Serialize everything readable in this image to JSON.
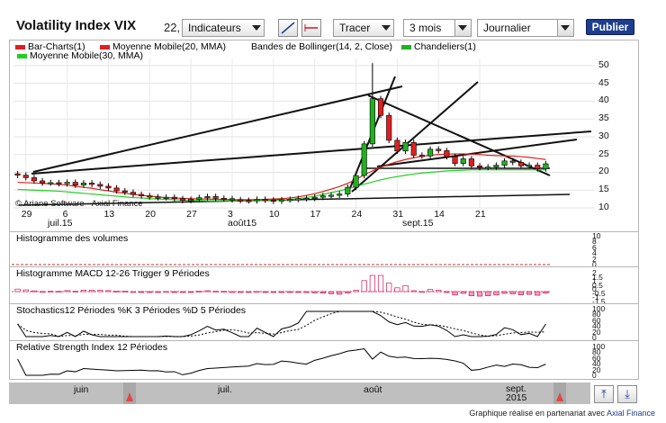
{
  "toolbar": {
    "title": "Volatility Index VIX",
    "number": "22,",
    "indicators_label": "Indicateurs",
    "draw_label": "Tracer",
    "period_value": "3 mois",
    "interval_value": "Journalier",
    "publish_label": "Publier",
    "line_tool_icon": "diagonal-line-icon",
    "hline_tool_icon": "horizontal-line-icon"
  },
  "legend": {
    "items": [
      {
        "label": "Bar-Charts(1)",
        "color": "#e02020",
        "icon": "bar-swatch"
      },
      {
        "label": "Moyenne Mobile(20, MMA)",
        "color": "#e02020",
        "icon": "line-swatch"
      },
      {
        "label": "Bandes de Bollinger(14, 2, Close)",
        "color": "",
        "icon": ""
      },
      {
        "label": "Chandeliers(1)",
        "color": "#20b020",
        "icon": "bar-swatch"
      },
      {
        "label": "Moyenne Mobile(30, MMA)",
        "color": "#20d020",
        "icon": "line-swatch"
      }
    ]
  },
  "main_chart": {
    "watermark": "© Ariane Software - Axial Finance",
    "y_ticks": [
      "50",
      "45",
      "40",
      "35",
      "30",
      "25",
      "20",
      "15",
      "10"
    ],
    "x_ticks": [
      "29",
      "6",
      "13",
      "20",
      "27",
      "3",
      "10",
      "17",
      "24",
      "31",
      "14",
      "21"
    ],
    "month_labels": [
      "juil.15",
      "août15",
      "sept.15"
    ]
  },
  "chart_data": {
    "type": "candlestick",
    "ylim": [
      10,
      52
    ],
    "y_ticks": [
      10,
      15,
      20,
      25,
      30,
      35,
      40,
      45,
      50
    ],
    "x_tick_labels": [
      "29",
      "6",
      "13",
      "20",
      "27",
      "3",
      "10",
      "17",
      "24",
      "31",
      "14",
      "21"
    ],
    "series": [
      {
        "name": "Chandeliers(1)",
        "close": [
          19.2,
          18.5,
          17.6,
          17.0,
          17.1,
          16.8,
          17.2,
          16.4,
          17.0,
          16.6,
          16.1,
          15.6,
          14.8,
          14.4,
          13.8,
          13.4,
          13.1,
          12.9,
          13.0,
          12.6,
          12.1,
          12.4,
          12.9,
          13.2,
          12.7,
          12.6,
          12.3,
          12.1,
          12.0,
          12.4,
          12.2,
          11.9,
          12.3,
          12.4,
          12.6,
          12.7,
          13.0,
          13.4,
          13.6,
          13.9,
          15.8,
          19.1,
          28.0,
          40.7,
          36.0,
          29.0,
          26.0,
          28.4,
          24.8,
          24.6,
          26.5,
          26.1,
          24.4,
          22.5,
          23.8,
          21.8,
          21.4,
          21.5,
          22.0,
          23.2,
          22.8,
          21.8,
          22.0,
          21.0,
          22.4
        ]
      },
      {
        "name": "Moyenne Mobile(20, MMA)",
        "values": [
          17.2,
          17.1,
          17.0,
          16.9,
          16.8,
          16.6,
          16.4,
          16.1,
          15.8,
          15.5,
          15.1,
          14.8,
          14.4,
          14.1,
          13.8,
          13.5,
          13.3,
          13.1,
          12.9,
          12.8,
          12.7,
          12.6,
          12.5,
          12.5,
          12.4,
          12.4,
          12.3,
          12.3,
          12.3,
          12.3,
          12.4,
          12.5,
          12.6,
          12.8,
          13.1,
          13.5,
          14.0,
          14.6,
          15.3,
          16.0,
          16.9,
          18.0,
          19.3,
          20.4,
          21.4,
          22.3,
          23.0,
          23.6,
          24.1,
          24.5,
          24.8,
          25.0,
          25.1,
          25.2,
          25.2,
          25.1,
          25.0,
          24.8,
          24.7,
          24.6,
          24.6,
          24.4,
          24.2,
          23.9,
          23.6
        ]
      },
      {
        "name": "Moyenne Mobile(30, MMA)",
        "values": [
          15.2,
          15.1,
          15.0,
          14.9,
          14.8,
          14.7,
          14.5,
          14.3,
          14.1,
          13.9,
          13.7,
          13.5,
          13.3,
          13.1,
          12.9,
          12.8,
          12.6,
          12.5,
          12.4,
          12.3,
          12.2,
          12.1,
          12.1,
          12.0,
          12.0,
          12.0,
          12.0,
          12.0,
          12.0,
          12.0,
          12.1,
          12.1,
          12.2,
          12.4,
          12.6,
          12.9,
          13.3,
          13.8,
          14.3,
          14.8,
          15.4,
          16.0,
          16.7,
          17.3,
          17.9,
          18.4,
          18.8,
          19.2,
          19.5,
          19.8,
          20.0,
          20.2,
          20.4,
          20.5,
          20.6,
          20.7,
          20.7,
          20.7,
          20.7,
          20.7,
          20.7,
          20.7,
          20.7,
          20.7,
          20.7
        ]
      }
    ],
    "grid": true
  },
  "panels": {
    "volume": {
      "label": "Histogramme des volumes",
      "ticks": [
        "10",
        "8",
        "6",
        "4",
        "2",
        "0"
      ]
    },
    "macd": {
      "label": "Histogramme MACD 12-26   Trigger 9 Périodes",
      "ticks": [
        "2",
        "1.5",
        "1",
        "0.5",
        "0",
        "-0.5",
        "-1",
        "-1.5"
      ]
    },
    "stoch": {
      "label": "Stochastics12 Périodes   %K 3 Périodes   %D 5 Périodes",
      "ticks": [
        "100",
        "80",
        "60",
        "40",
        "20",
        "0"
      ]
    },
    "rsi": {
      "label": "Relative Strength Index 12 Périodes",
      "ticks": [
        "100",
        "80",
        "60",
        "40",
        "20",
        "0"
      ]
    }
  },
  "navigator": {
    "labels": [
      "juin",
      "juil.",
      "août",
      "sept.",
      "2015"
    ],
    "scroll_up_icon": "pan-up-icon",
    "scroll_down_icon": "pan-down-icon"
  },
  "credit": {
    "text": "Graphique réalisé en partenariat avec",
    "link": "Axial Finance"
  }
}
